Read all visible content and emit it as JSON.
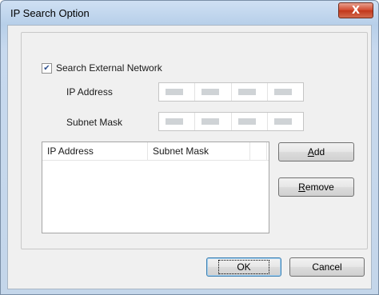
{
  "window": {
    "title": "IP Search Option",
    "close_label": "X"
  },
  "search_external": {
    "label": "Search External Network",
    "checked": true
  },
  "ip_address": {
    "label": "IP Address"
  },
  "subnet_mask": {
    "label": "Subnet Mask"
  },
  "table": {
    "columns": [
      "IP Address",
      "Subnet Mask",
      ""
    ]
  },
  "buttons": {
    "add": {
      "label": "Add",
      "mnemonic": "A",
      "rest": "dd"
    },
    "remove": {
      "label": "Remove",
      "mnemonic": "R",
      "rest": "emove"
    },
    "ok": "OK",
    "cancel": "Cancel"
  }
}
